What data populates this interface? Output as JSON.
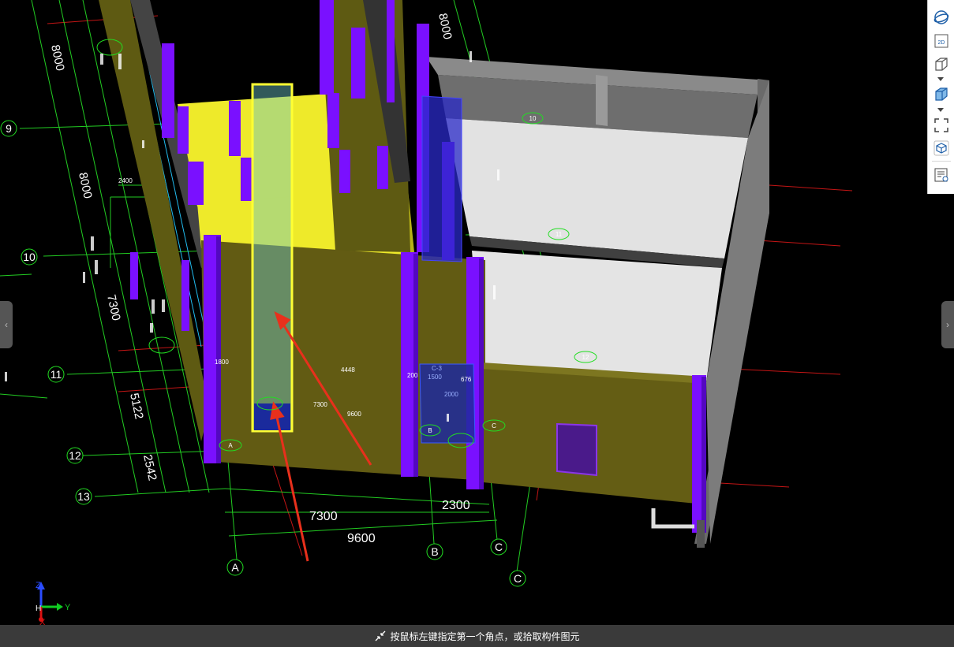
{
  "grid": {
    "rows": [
      "9",
      "10",
      "11",
      "12",
      "13"
    ],
    "cols": [
      "A",
      "B",
      "C",
      "C"
    ],
    "left_dims": [
      "8000",
      "8000",
      "7300",
      "5122",
      "2542"
    ],
    "top_dims": [
      "8000"
    ],
    "bottom_dims": [
      "7300",
      "2300",
      "9600"
    ]
  },
  "labels": {
    "mid_1800": "1800",
    "mid_4448": "4448",
    "mid_200": "200",
    "mid_676": "676",
    "mid_7300": "7300",
    "mid_9600": "9600",
    "mid_2400": "2400",
    "mid_1500": "1500",
    "mid_2000": "2000",
    "window_tag": "C-3",
    "circle_A": "A",
    "circle_B": "B",
    "circle_C": "C",
    "circle_10": "10",
    "circle_11": "11",
    "circle_12": "12"
  },
  "axes": {
    "z": "Z",
    "y": "Y",
    "x": "X",
    "origin": "H"
  },
  "status": {
    "message": "按鼠标左键指定第一个角点，或拾取构件图元"
  },
  "toolbar": {
    "items": [
      "orbit-icon",
      "view-2d-icon",
      "view-3d-icon",
      "view-3d-solid-icon",
      "fit-screen-icon",
      "view-cube-icon",
      "properties-list-icon"
    ],
    "label_2d": "2D"
  },
  "colors": {
    "wall": "#6b6112",
    "column": "#7a10ff",
    "slab_yellow": "#f0f02a",
    "grid_green": "#22dd22",
    "grid_red": "#cc1111",
    "highlight": "#ffff33",
    "arrow": "#e8301c"
  }
}
